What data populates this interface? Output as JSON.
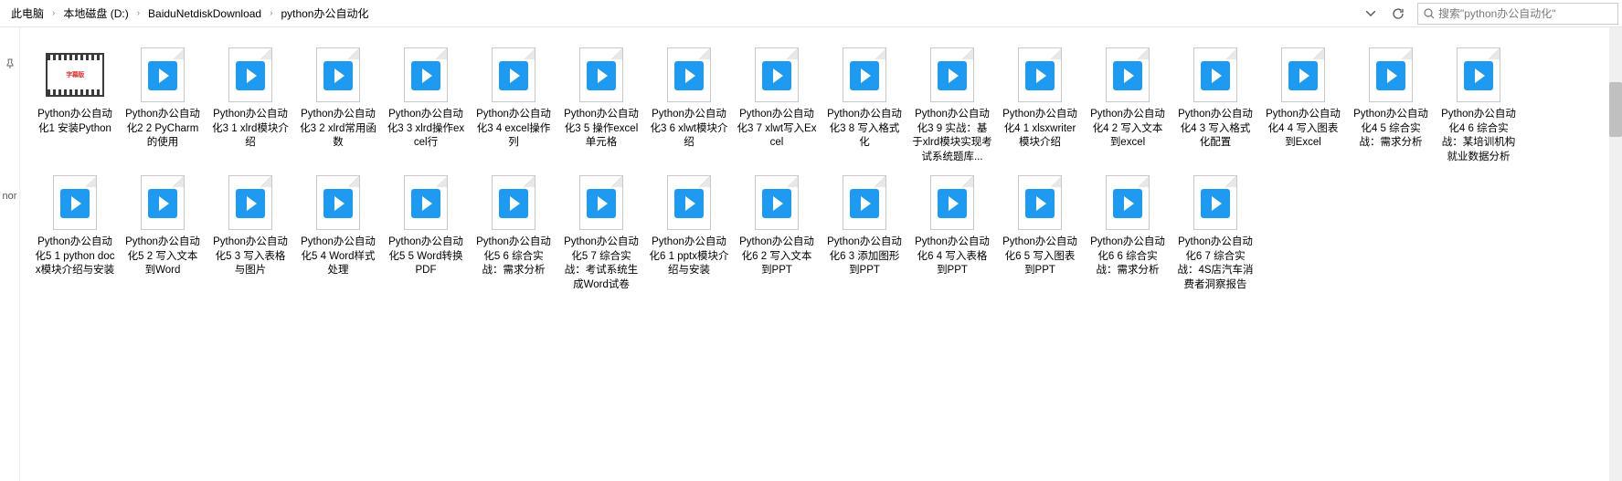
{
  "breadcrumb": [
    {
      "label": "此电脑"
    },
    {
      "label": "本地磁盘 (D:)"
    },
    {
      "label": "BaiduNetdiskDownload"
    },
    {
      "label": "python办公自动化"
    }
  ],
  "search": {
    "placeholder": "搜索\"python办公自动化\""
  },
  "left_strip": {
    "top": "",
    "bottom": "nor"
  },
  "icons": {
    "first_frame_text": "字幕版"
  },
  "files": [
    {
      "name": "Python办公自动化1 安装Python",
      "type": "frame"
    },
    {
      "name": "Python办公自动化2 2 PyCharm的使用",
      "type": "video"
    },
    {
      "name": "Python办公自动化3 1 xlrd模块介绍",
      "type": "video"
    },
    {
      "name": "Python办公自动化3 2 xlrd常用函数",
      "type": "video"
    },
    {
      "name": "Python办公自动化3 3 xlrd操作excel行",
      "type": "video"
    },
    {
      "name": "Python办公自动化3 4 excel操作列",
      "type": "video"
    },
    {
      "name": "Python办公自动化3 5 操作excel单元格",
      "type": "video"
    },
    {
      "name": "Python办公自动化3 6 xlwt模块介绍",
      "type": "video"
    },
    {
      "name": "Python办公自动化3 7 xlwt写入Excel",
      "type": "video"
    },
    {
      "name": "Python办公自动化3 8 写入格式化",
      "type": "video"
    },
    {
      "name": "Python办公自动化3 9 实战：基于xlrd模块实现考试系统题库...",
      "type": "video"
    },
    {
      "name": "Python办公自动化4 1 xlsxwriter模块介绍",
      "type": "video"
    },
    {
      "name": "Python办公自动化4 2 写入文本到excel",
      "type": "video"
    },
    {
      "name": "Python办公自动化4 3 写入格式化配置",
      "type": "video"
    },
    {
      "name": "Python办公自动化4 4 写入图表到Excel",
      "type": "video"
    },
    {
      "name": "Python办公自动化4 5 综合实战：需求分析",
      "type": "video"
    },
    {
      "name": "Python办公自动化4 6 综合实战：某培训机构就业数据分析",
      "type": "video"
    },
    {
      "name": "Python办公自动化5 1 python docx模块介绍与安装",
      "type": "video"
    },
    {
      "name": "Python办公自动化5 2 写入文本到Word",
      "type": "video"
    },
    {
      "name": "Python办公自动化5 3 写入表格与图片",
      "type": "video"
    },
    {
      "name": "Python办公自动化5 4 Word样式处理",
      "type": "video"
    },
    {
      "name": "Python办公自动化5 5 Word转换PDF",
      "type": "video"
    },
    {
      "name": "Python办公自动化5 6 综合实战：需求分析",
      "type": "video"
    },
    {
      "name": "Python办公自动化5 7 综合实战：考试系统生成Word试卷",
      "type": "video"
    },
    {
      "name": "Python办公自动化6 1 pptx模块介绍与安装",
      "type": "video"
    },
    {
      "name": "Python办公自动化6 2 写入文本到PPT",
      "type": "video"
    },
    {
      "name": "Python办公自动化6 3 添加图形到PPT",
      "type": "video"
    },
    {
      "name": "Python办公自动化6 4 写入表格到PPT",
      "type": "video"
    },
    {
      "name": "Python办公自动化6 5 写入图表到PPT",
      "type": "video"
    },
    {
      "name": "Python办公自动化6 6 综合实战：需求分析",
      "type": "video"
    },
    {
      "name": "Python办公自动化6 7 综合实战：4S店汽车消费者洞察报告",
      "type": "video"
    }
  ]
}
